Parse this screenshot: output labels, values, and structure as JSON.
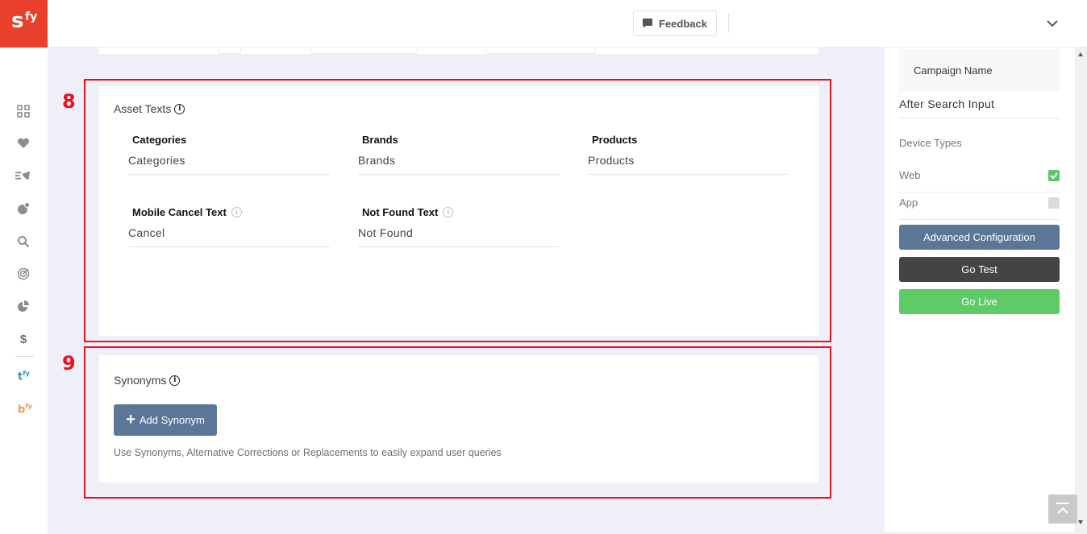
{
  "app": {
    "logo_main": "s",
    "logo_super": "fy"
  },
  "header": {
    "feedback_label": "Feedback",
    "feedback_icon": "chat-bubble-icon",
    "menu_icon": "chevron-down-icon"
  },
  "sidebar": {
    "items": [
      {
        "icon": "grid-icon"
      },
      {
        "icon": "heart-icon"
      },
      {
        "icon": "campaign-icon"
      },
      {
        "icon": "segments-icon"
      },
      {
        "icon": "search-icon"
      },
      {
        "icon": "target-icon"
      },
      {
        "icon": "pie-chart-icon"
      },
      {
        "icon": "dollar-icon"
      }
    ],
    "brand_t": "t",
    "brand_t_super": "fy",
    "brand_b": "b",
    "brand_b_super": "fy"
  },
  "annotations": {
    "box8": "8",
    "box9": "9"
  },
  "asset_texts": {
    "title": "Asset Texts",
    "fields": [
      {
        "label": "Categories",
        "value": "Categories"
      },
      {
        "label": "Brands",
        "value": "Brands"
      },
      {
        "label": "Products",
        "value": "Products"
      },
      {
        "label": "Mobile Cancel Text",
        "value": "Cancel"
      },
      {
        "label": "Not Found Text",
        "value": "Not Found"
      }
    ]
  },
  "synonyms": {
    "title": "Synonyms",
    "add_button": "Add Synonym",
    "help_text": "Use Synonyms, Alternative Corrections or Replacements to easily expand user queries"
  },
  "right_panel": {
    "campaign_name_label": "Campaign Name",
    "campaign_type": "After Search Input",
    "device_types_label": "Device Types",
    "devices": [
      {
        "label": "Web",
        "checked": true
      },
      {
        "label": "App",
        "checked": false
      }
    ],
    "advanced_config_label": "Advanced Configuration",
    "go_test_label": "Go Test",
    "go_live_label": "Go Live"
  },
  "colors": {
    "brand_red": "#e8402a",
    "annotation_red": "#e8121f",
    "advanced_btn": "#5a7797",
    "go_test_btn": "#444446",
    "go_live_btn": "#5fcb67",
    "checkbox_on": "#5cc56b"
  }
}
